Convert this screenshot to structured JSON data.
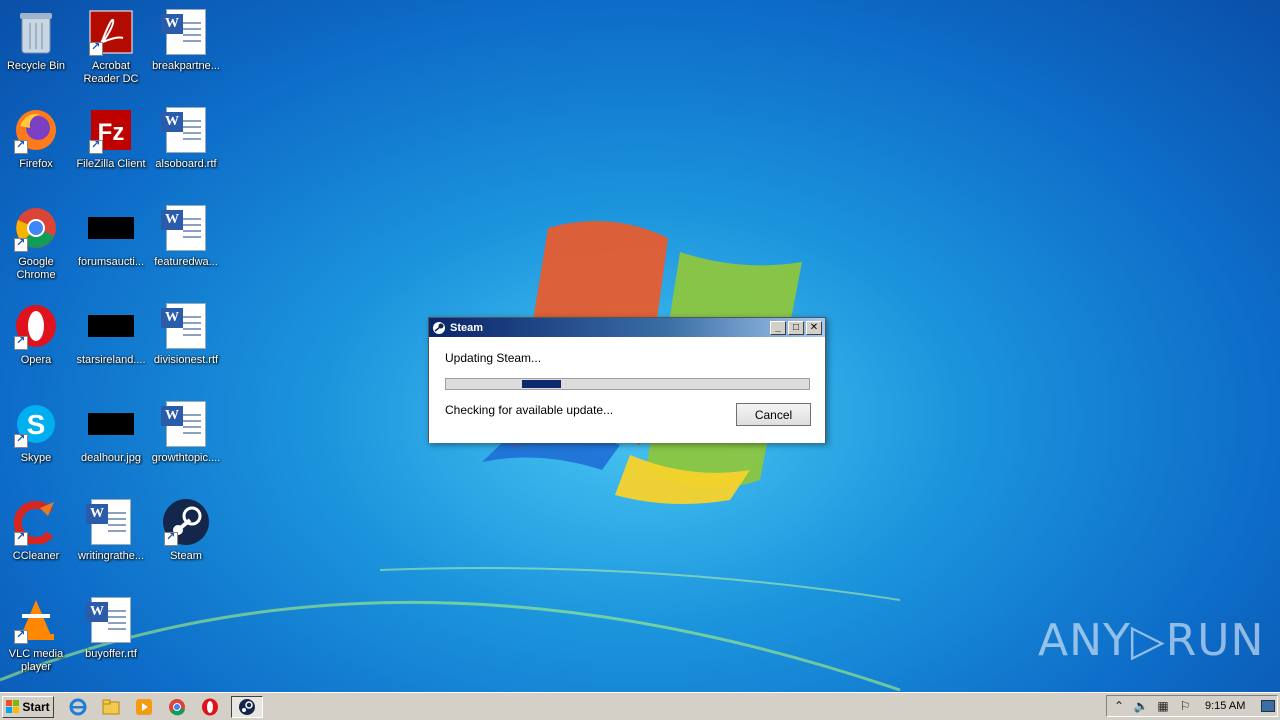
{
  "desktop": {
    "icons": [
      {
        "label": "Recycle Bin",
        "icon": "recycle-bin-icon"
      },
      {
        "label": "Acrobat Reader DC",
        "icon": "acrobat-icon"
      },
      {
        "label": "breakpartne...",
        "icon": "word-document-icon"
      },
      {
        "label": "Firefox",
        "icon": "firefox-icon"
      },
      {
        "label": "FileZilla Client",
        "icon": "filezilla-icon"
      },
      {
        "label": "alsoboard.rtf",
        "icon": "word-document-icon"
      },
      {
        "label": "Google Chrome",
        "icon": "chrome-icon"
      },
      {
        "label": "forumsaucti...",
        "icon": "image-file-icon"
      },
      {
        "label": "featuredwa...",
        "icon": "word-document-icon"
      },
      {
        "label": "Opera",
        "icon": "opera-icon"
      },
      {
        "label": "starsireland....",
        "icon": "image-file-icon"
      },
      {
        "label": "divisionest.rtf",
        "icon": "word-document-icon"
      },
      {
        "label": "Skype",
        "icon": "skype-icon"
      },
      {
        "label": "dealhour.jpg",
        "icon": "image-file-icon"
      },
      {
        "label": "growthtopic....",
        "icon": "word-document-icon"
      },
      {
        "label": "CCleaner",
        "icon": "ccleaner-icon"
      },
      {
        "label": "writingrathe...",
        "icon": "word-document-icon"
      },
      {
        "label": "Steam",
        "icon": "steam-icon"
      },
      {
        "label": "VLC media player",
        "icon": "vlc-icon"
      },
      {
        "label": "buyoffer.rtf",
        "icon": "word-document-icon"
      }
    ]
  },
  "dialog": {
    "title": "Steam",
    "status": "Updating Steam...",
    "progress": 0.1,
    "detail": "Checking for available update...",
    "cancel_label": "Cancel"
  },
  "taskbar": {
    "start_label": "Start",
    "quick_launch": [
      "internet-explorer-icon",
      "folder-icon",
      "media-player-icon",
      "chrome-icon",
      "opera-icon"
    ],
    "active_task": "steam-icon",
    "clock": "9:15 AM"
  },
  "watermark": "ANY▷RUN",
  "colors": {
    "dialog_title_start": "#0a246a",
    "progress_fill": "#0b2a6b",
    "taskbar": "#d4d0c8"
  }
}
